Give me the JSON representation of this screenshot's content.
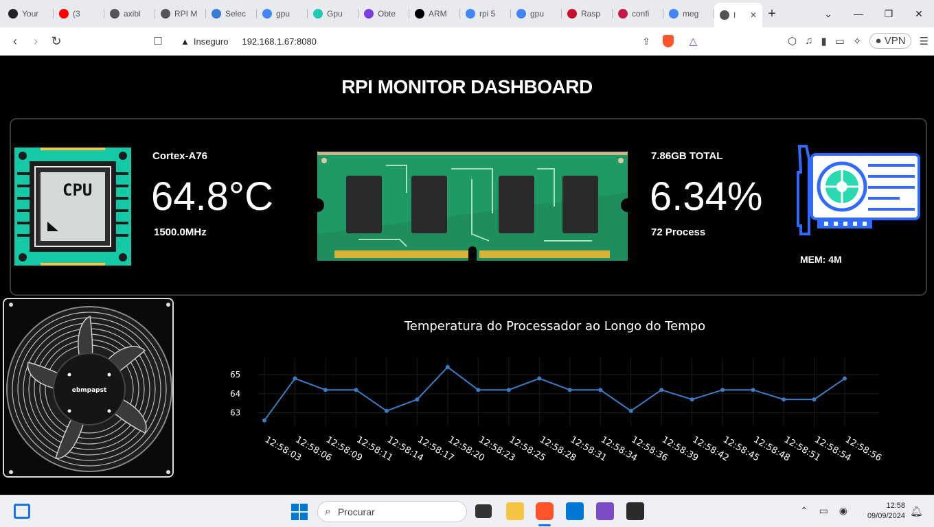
{
  "browser": {
    "tabs": [
      {
        "label": "Your",
        "fav": "github-icon",
        "color": "#222"
      },
      {
        "label": "(3",
        "fav": "youtube-icon",
        "color": "#ff0000"
      },
      {
        "label": "axibl",
        "fav": "globe-icon",
        "color": "#555"
      },
      {
        "label": "RPI M",
        "fav": "globe-icon",
        "color": "#555"
      },
      {
        "label": "Selec",
        "fav": "app-icon",
        "color": "#3a7bd5"
      },
      {
        "label": "gpu",
        "fav": "google-icon",
        "color": "#4285f4"
      },
      {
        "label": "Gpu",
        "fav": "vuetify-icon",
        "color": "#1ec9b0"
      },
      {
        "label": "Obte",
        "fav": "app-icon",
        "color": "#7b3fe4"
      },
      {
        "label": "ARM",
        "fav": "wikipedia-icon",
        "color": "#000"
      },
      {
        "label": "rpi 5",
        "fav": "google-icon",
        "color": "#4285f4"
      },
      {
        "label": "gpu",
        "fav": "google-icon",
        "color": "#4285f4"
      },
      {
        "label": "Rasp",
        "fav": "pc-icon",
        "color": "#c8102e"
      },
      {
        "label": "confi",
        "fav": "raspberry-icon",
        "color": "#c51a4a"
      },
      {
        "label": "meg",
        "fav": "google-icon",
        "color": "#4285f4"
      },
      {
        "label": "I",
        "fav": "globe-icon",
        "color": "#555"
      }
    ],
    "security_label": "Inseguro",
    "url": "192.168.1.67:8080",
    "vpn_label": "VPN"
  },
  "dashboard": {
    "title": "RPI MONITOR DASHBOARD",
    "cpu": {
      "model": "Cortex-A76",
      "temperature": "64.8°C",
      "frequency": "1500.0MHz",
      "chip_label": "CPU"
    },
    "memory": {
      "total": "7.86GB TOTAL",
      "usage": "6.34%",
      "processes": "72 Process"
    },
    "gpu": {
      "memory": "MEM: 4M"
    },
    "fan": {
      "brand": "ebmpapst"
    }
  },
  "chart_data": {
    "type": "line",
    "title": "Temperatura do Processador ao Longo do Tempo",
    "xlabel": "",
    "ylabel": "",
    "x": [
      "12:58:03",
      "12:58:06",
      "12:58:09",
      "12:58:11",
      "12:58:14",
      "12:58:17",
      "12:58:20",
      "12:58:23",
      "12:58:25",
      "12:58:28",
      "12:58:31",
      "12:58:34",
      "12:58:36",
      "12:58:39",
      "12:58:42",
      "12:58:45",
      "12:58:48",
      "12:58:51",
      "12:58:54",
      "12:58:56"
    ],
    "series": [
      {
        "values": [
          62.6,
          64.8,
          64.2,
          64.2,
          63.1,
          63.7,
          65.4,
          64.2,
          64.2,
          64.8,
          64.2,
          64.2,
          63.1,
          64.2,
          63.7,
          64.2,
          64.2,
          63.7,
          63.7,
          64.8
        ],
        "color": "#3b7dc4"
      }
    ],
    "yticks": [
      63,
      64,
      65
    ],
    "ylim": [
      62.3,
      65.9
    ],
    "grid": true
  },
  "taskbar": {
    "search_placeholder": "Procurar",
    "time": "12:58",
    "date": "09/09/2024"
  }
}
